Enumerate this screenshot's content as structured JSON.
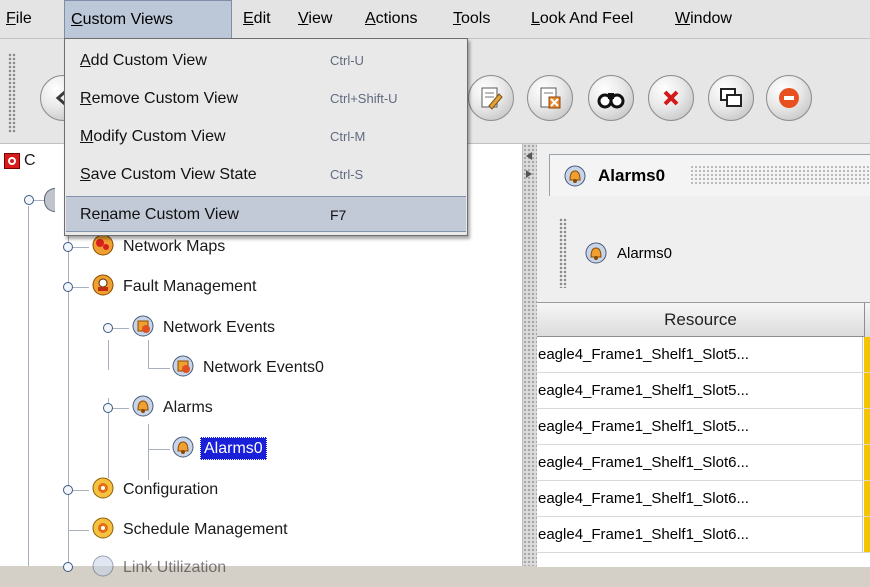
{
  "menubar": {
    "items": [
      {
        "label": "File",
        "mnemonic": "F",
        "rest": "ile"
      },
      {
        "label": "Custom Views",
        "mnemonic": "C",
        "rest": "ustom Views"
      },
      {
        "label": "Edit",
        "mnemonic": "E",
        "rest": "dit"
      },
      {
        "label": "View",
        "mnemonic": "V",
        "rest": "iew"
      },
      {
        "label": "Actions",
        "mnemonic": "A",
        "rest": "ctions"
      },
      {
        "label": "Tools",
        "mnemonic": "T",
        "rest": "ools"
      },
      {
        "label": "Look And Feel",
        "mnemonic": "L",
        "rest": "ook And Feel"
      },
      {
        "label": "Window",
        "mnemonic": "W",
        "rest": "indow"
      }
    ]
  },
  "custom_views_menu": {
    "items": [
      {
        "pre": "",
        "mn": "A",
        "post": "dd Custom View",
        "shortcut": "Ctrl-U"
      },
      {
        "pre": "",
        "mn": "R",
        "post": "emove Custom View",
        "shortcut": "Ctrl+Shift-U"
      },
      {
        "pre": "",
        "mn": "M",
        "post": "odify Custom View",
        "shortcut": "Ctrl-M"
      },
      {
        "pre": "",
        "mn": "S",
        "post": "ave Custom View State",
        "shortcut": "Ctrl-S"
      },
      {
        "pre": "Re",
        "mn": "n",
        "post": "ame Custom View",
        "shortcut": "F7"
      }
    ],
    "highlighted_index": 4
  },
  "tree": {
    "root_partial": "C",
    "nodes": [
      {
        "label": "Network Maps",
        "icon": "network-maps-icon"
      },
      {
        "label": "Fault Management",
        "icon": "fault-management-icon"
      },
      {
        "label": "Network Events",
        "icon": "network-events-icon"
      },
      {
        "label": "Network Events0",
        "icon": "network-events-icon"
      },
      {
        "label": "Alarms",
        "icon": "alarm-bell-icon"
      },
      {
        "label": "Alarms0",
        "icon": "alarm-bell-icon"
      },
      {
        "label": "Configuration",
        "icon": "configuration-icon"
      },
      {
        "label": "Schedule Management",
        "icon": "schedule-icon"
      },
      {
        "label": "Link Utilization",
        "icon": "link-utilization-icon"
      }
    ],
    "selected": "Alarms0"
  },
  "panel": {
    "tab_title": "Alarms0",
    "inner_label": "Alarms0",
    "column_header": "Resource",
    "rows": [
      "eagle4_Frame1_Shelf1_Slot5...",
      "eagle4_Frame1_Shelf1_Slot5...",
      "eagle4_Frame1_Shelf1_Slot5...",
      "eagle4_Frame1_Shelf1_Slot6...",
      "eagle4_Frame1_Shelf1_Slot6...",
      "eagle4_Frame1_Shelf1_Slot6..."
    ],
    "severity_color": "#f4c400"
  },
  "colors": {
    "menu_highlight": "#c2cad8",
    "selection": "#1a20d8"
  }
}
